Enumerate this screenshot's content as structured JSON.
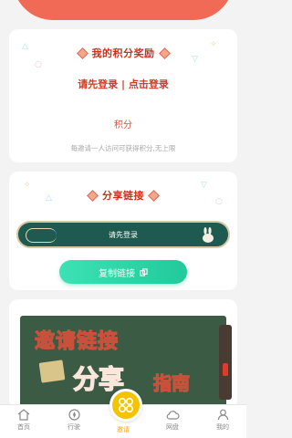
{
  "rewards": {
    "title": "我的积分奖励",
    "login_prompt": "请先登录",
    "separator": " | ",
    "click_login": "点击登录",
    "points_label": "积分",
    "hint": "每邀请一人访问可获得积分,无上限"
  },
  "share": {
    "title": "分享链接",
    "banner_text": "请先登录",
    "copy_label": "复制链接"
  },
  "guide": {
    "line1": "邀请链接",
    "line2": "分享",
    "line3": "指南"
  },
  "tabbar": {
    "items": [
      {
        "label": "首页",
        "icon": "home-icon"
      },
      {
        "label": "行驶",
        "icon": "compass-icon"
      },
      {
        "label": "邀请",
        "icon": "invite-icon",
        "active": true
      },
      {
        "label": "网盘",
        "icon": "cloud-icon"
      },
      {
        "label": "我的",
        "icon": "user-icon"
      }
    ]
  },
  "colors": {
    "accent": "#f06a55",
    "title_red": "#c8321c",
    "button_green": "#22c99b",
    "banner_green": "#1e5a4f",
    "center_yellow": "#f5c400"
  }
}
